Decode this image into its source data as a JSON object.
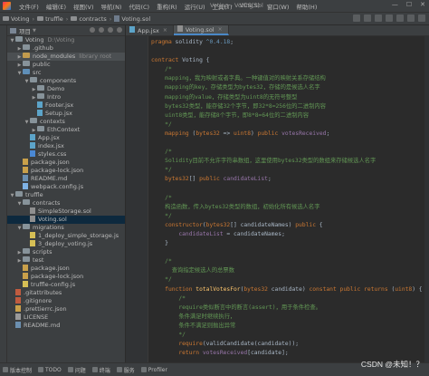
{
  "menu": {
    "items": [
      "文件(F)",
      "编辑(E)",
      "视图(V)",
      "导航(N)",
      "代码(C)",
      "重构(R)",
      "运行(U)",
      "工具(T)",
      "VCS(S)",
      "窗口(W)",
      "帮助(H)"
    ],
    "window_title": "Voting - Voting.sol"
  },
  "breadcrumb": [
    "Voting",
    "truffle",
    "contracts",
    "Voting.sol"
  ],
  "project_panel": {
    "title": "项目",
    "tree": [
      {
        "label": "Voting",
        "secondary": "D:\\Voting",
        "indent": 0,
        "arrow": "▼",
        "icon": "folder"
      },
      {
        "label": ".github",
        "indent": 1,
        "arrow": "▶",
        "icon": "folder"
      },
      {
        "label": "node_modules",
        "secondary": "library root",
        "indent": 1,
        "arrow": "▶",
        "icon": "folder excluded",
        "highlight": true
      },
      {
        "label": "public",
        "indent": 1,
        "arrow": "▶",
        "icon": "folder"
      },
      {
        "label": "src",
        "indent": 1,
        "arrow": "▼",
        "icon": "folder src"
      },
      {
        "label": "components",
        "indent": 2,
        "arrow": "▼",
        "icon": "folder"
      },
      {
        "label": "Demo",
        "indent": 3,
        "arrow": "▶",
        "icon": "folder"
      },
      {
        "label": "Intro",
        "indent": 3,
        "arrow": "▶",
        "icon": "folder"
      },
      {
        "label": "Footer.jsx",
        "indent": 3,
        "arrow": "",
        "icon": "file jsx"
      },
      {
        "label": "Setup.jsx",
        "indent": 3,
        "arrow": "",
        "icon": "file jsx"
      },
      {
        "label": "contexts",
        "indent": 2,
        "arrow": "▼",
        "icon": "folder"
      },
      {
        "label": "EthContext",
        "indent": 3,
        "arrow": "▶",
        "icon": "folder"
      },
      {
        "label": "App.jsx",
        "indent": 2,
        "arrow": "",
        "icon": "file jsx"
      },
      {
        "label": "index.jsx",
        "indent": 2,
        "arrow": "",
        "icon": "file jsx"
      },
      {
        "label": "styles.css",
        "indent": 2,
        "arrow": "",
        "icon": "file css"
      },
      {
        "label": "package.json",
        "indent": 1,
        "arrow": "",
        "icon": "file json"
      },
      {
        "label": "package-lock.json",
        "indent": 1,
        "arrow": "",
        "icon": "file json"
      },
      {
        "label": "README.md",
        "indent": 1,
        "arrow": "",
        "icon": "file md"
      },
      {
        "label": "webpack.config.js",
        "indent": 1,
        "arrow": "",
        "icon": "file webpack"
      },
      {
        "label": "truffle",
        "indent": 0,
        "arrow": "▼",
        "icon": "folder"
      },
      {
        "label": "contracts",
        "indent": 1,
        "arrow": "▼",
        "icon": "folder"
      },
      {
        "label": "SimpleStorage.sol",
        "indent": 2,
        "arrow": "",
        "icon": "file sol"
      },
      {
        "label": "Voting.sol",
        "indent": 2,
        "arrow": "",
        "icon": "file sol",
        "selected": true
      },
      {
        "label": "migrations",
        "indent": 1,
        "arrow": "▼",
        "icon": "folder"
      },
      {
        "label": "1_deploy_simple_storage.js",
        "indent": 2,
        "arrow": "",
        "icon": "file js"
      },
      {
        "label": "3_deploy_voting.js",
        "indent": 2,
        "arrow": "",
        "icon": "file js"
      },
      {
        "label": "scripts",
        "indent": 1,
        "arrow": "▶",
        "icon": "folder"
      },
      {
        "label": "test",
        "indent": 1,
        "arrow": "▶",
        "icon": "folder"
      },
      {
        "label": "package.json",
        "indent": 1,
        "arrow": "",
        "icon": "file json"
      },
      {
        "label": "package-lock.json",
        "indent": 1,
        "arrow": "",
        "icon": "file json"
      },
      {
        "label": "truffle-config.js",
        "indent": 1,
        "arrow": "",
        "icon": "file js"
      },
      {
        "label": ".gitattributes",
        "indent": 0,
        "arrow": "",
        "icon": "file git"
      },
      {
        "label": ".gitignore",
        "indent": 0,
        "arrow": "",
        "icon": "file git"
      },
      {
        "label": ".prettierrc.json",
        "indent": 0,
        "arrow": "",
        "icon": "file json"
      },
      {
        "label": "LICENSE",
        "indent": 0,
        "arrow": "",
        "icon": "file lic"
      },
      {
        "label": "README.md",
        "indent": 0,
        "arrow": "",
        "icon": "file md"
      }
    ]
  },
  "tabs": [
    {
      "label": "App.jsx",
      "active": false
    },
    {
      "label": "Voting.sol",
      "active": true
    }
  ],
  "code_lines": [
    [
      [
        "kw",
        "pragma "
      ],
      [
        "id",
        "solidity "
      ],
      [
        "num",
        "^0.4.18"
      ],
      [
        "id",
        ";"
      ]
    ],
    [],
    [
      [
        "kw",
        "contract "
      ],
      [
        "id",
        "Voting {"
      ]
    ],
    [
      [
        "cm",
        "    /*"
      ]
    ],
    [
      [
        "cm",
        "    mapping，我为映射或者字典。一种键值对的映射关系存储结构"
      ]
    ],
    [
      [
        "cm",
        "    mapping的key，存储类型为bytes32，存储的是候选人名字"
      ]
    ],
    [
      [
        "cm",
        "    mapping的value，存储类型为uint8的无符号整型"
      ]
    ],
    [
      [
        "cm",
        "    bytes32类型，能存储32个字节，即32*8=256位的二进制内容"
      ]
    ],
    [
      [
        "cm",
        "    uint8类型，能存储8个字节，即8*8=64位的二进制内容"
      ]
    ],
    [
      [
        "cm",
        "    */"
      ]
    ],
    [
      [
        "id",
        "    "
      ],
      [
        "kw",
        "mapping "
      ],
      [
        "id",
        "("
      ],
      [
        "kw",
        "bytes32 "
      ],
      [
        "id",
        "=> "
      ],
      [
        "kw",
        "uint8"
      ],
      [
        "id",
        ") "
      ],
      [
        "kw",
        "public "
      ],
      [
        "vr",
        "votesReceived"
      ],
      [
        "id",
        ";"
      ]
    ],
    [],
    [
      [
        "cm",
        "    /*"
      ]
    ],
    [
      [
        "cm",
        "    Solidity目前不允许字符串数组，这里使用bytes32类型的数组来存储候选人名字"
      ]
    ],
    [
      [
        "cm",
        "    */"
      ]
    ],
    [
      [
        "id",
        "    "
      ],
      [
        "kw",
        "bytes32"
      ],
      [
        "id",
        "[] "
      ],
      [
        "kw",
        "public "
      ],
      [
        "vr",
        "candidateList"
      ],
      [
        "id",
        ";"
      ]
    ],
    [],
    [
      [
        "cm",
        "    /*"
      ]
    ],
    [
      [
        "cm",
        "    构造函数，传入bytes32类型的数组，初始化所有候选人名字"
      ]
    ],
    [
      [
        "cm",
        "    */"
      ]
    ],
    [
      [
        "id",
        "    "
      ],
      [
        "kw",
        "constructor"
      ],
      [
        "id",
        "("
      ],
      [
        "kw",
        "bytes32"
      ],
      [
        "id",
        "[] candidateNames) "
      ],
      [
        "kw",
        "public "
      ],
      [
        "id",
        "{"
      ]
    ],
    [
      [
        "id",
        "        "
      ],
      [
        "vr",
        "candidateList "
      ],
      [
        "id",
        "= candidateNames;"
      ]
    ],
    [
      [
        "id",
        "    }"
      ]
    ],
    [],
    [
      [
        "cm",
        "    /*"
      ]
    ],
    [
      [
        "cm",
        "      查询指定候选人的总票数"
      ]
    ],
    [
      [
        "cm",
        "    */"
      ]
    ],
    [
      [
        "id",
        "    "
      ],
      [
        "kw",
        "function "
      ],
      [
        "fn",
        "totalVotesFor"
      ],
      [
        "id",
        "("
      ],
      [
        "kw",
        "bytes32 "
      ],
      [
        "id",
        "candidate) "
      ],
      [
        "kw",
        "constant public returns "
      ],
      [
        "id",
        "("
      ],
      [
        "kw",
        "uint8"
      ],
      [
        "id",
        ") {"
      ]
    ],
    [
      [
        "cm",
        "        /*"
      ]
    ],
    [
      [
        "cm",
        "        require类似断言中的断言(assert)，用于条件检查。"
      ]
    ],
    [
      [
        "cm",
        "        条件满足时继续执行，"
      ]
    ],
    [
      [
        "cm",
        "        条件不满足则抛出异常"
      ]
    ],
    [
      [
        "cm",
        "        */"
      ]
    ],
    [
      [
        "id",
        "        "
      ],
      [
        "kw",
        "require"
      ],
      [
        "id",
        "(validCandidate(candidate));"
      ]
    ],
    [
      [
        "id",
        "        "
      ],
      [
        "kw",
        "return "
      ],
      [
        "vr",
        "votesReceived"
      ],
      [
        "id",
        "[candidate];"
      ]
    ]
  ],
  "status_bar": {
    "items": [
      "版本控制",
      "TODO",
      "问题",
      "终端",
      "服务",
      "Profiler"
    ]
  },
  "watermark": "CSDN @未知！？"
}
